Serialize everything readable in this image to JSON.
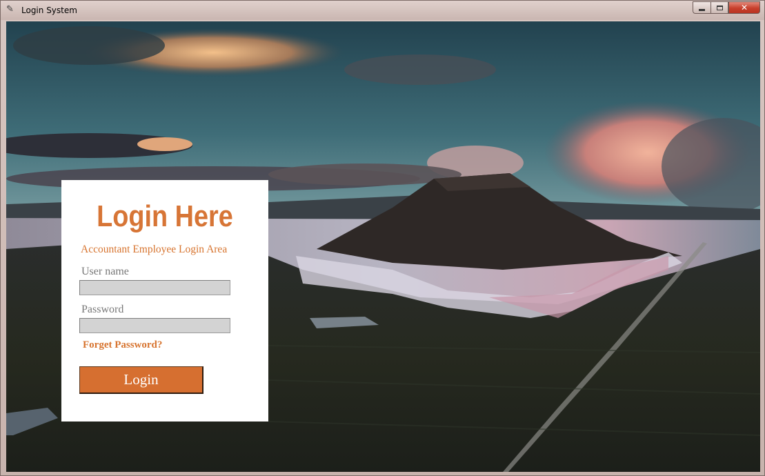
{
  "window": {
    "title": "Login System",
    "minimize_label": "▬",
    "maximize_label": "☐",
    "close_label": "✕"
  },
  "login": {
    "heading": "Login Here",
    "subtitle": "Accountant Employee Login Area",
    "username_label": "User name",
    "username_value": "",
    "password_label": "Password",
    "password_value": "",
    "forgot_label": "Forget Password?",
    "submit_label": "Login"
  },
  "colors": {
    "accent": "#d77536",
    "field_bg": "#d3d3d3",
    "card_bg": "#ffffff"
  },
  "background": {
    "description_icon": "landscape-photo"
  }
}
